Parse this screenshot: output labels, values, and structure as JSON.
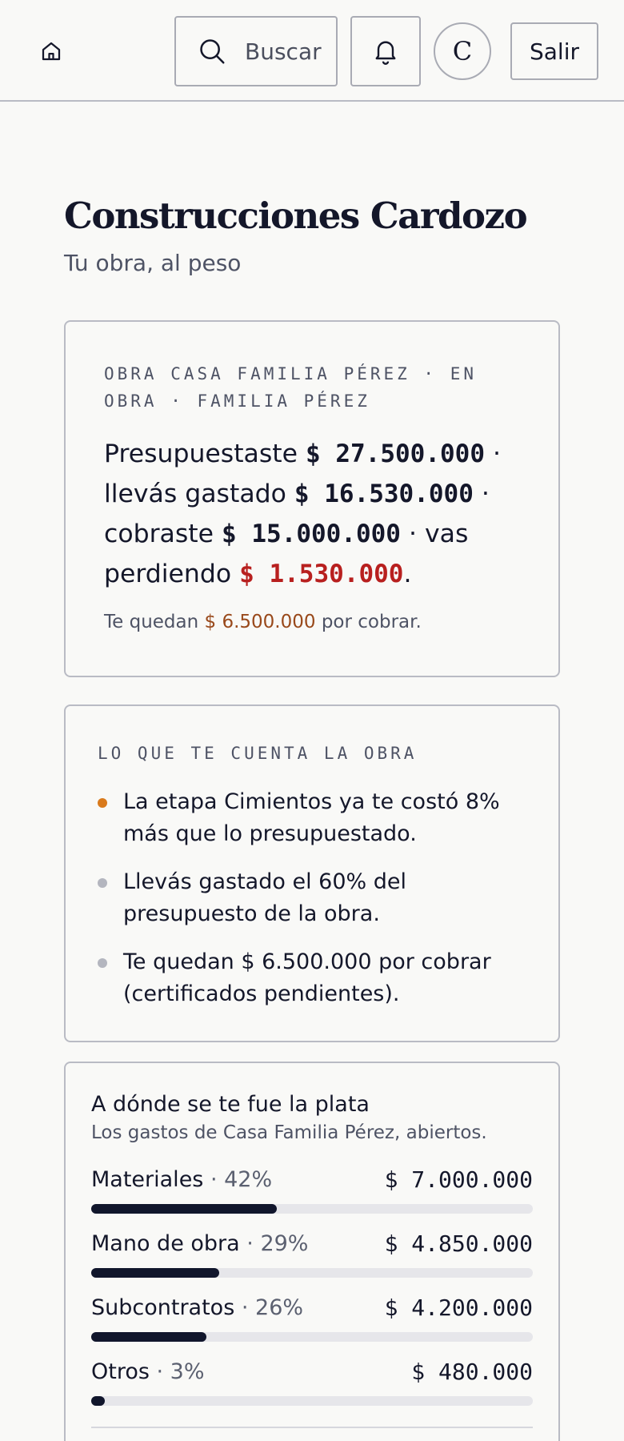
{
  "header": {
    "search_label": "Buscar",
    "avatar_initial": "C",
    "logout_label": "Salir"
  },
  "company": {
    "title": "Construcciones Cardozo",
    "subtitle": "Tu obra, al peso"
  },
  "summary": {
    "eyebrow": "OBRA CASA FAMILIA PÉREZ · EN OBRA · FAMILIA PÉREZ",
    "t1": "Presupuestaste ",
    "budget": "$ 27.500.000",
    "t2": " · llevás gastado ",
    "spent": "$ 16.530.000",
    "t3": " · cobraste ",
    "collected": "$ 15.000.000",
    "t4": " · vas perdiendo ",
    "loss": "$ 1.530.000",
    "t5": ".",
    "foot_pre": "Te quedan ",
    "foot_amount": "$ 6.500.000",
    "foot_post": " por cobrar."
  },
  "insights": {
    "eyebrow": "LO QUE TE CUENTA LA OBRA",
    "items": [
      {
        "text": "La etapa Cimientos ya te costó 8% más que lo presupuestado.",
        "dot_color": "#d97a1c"
      },
      {
        "text": "Llevás gastado el 60% del presupuesto de la obra.",
        "dot_color": "#b4b6bf"
      },
      {
        "text": "Te quedan $ 6.500.000 por cobrar (certificados pendientes).",
        "dot_color": "#b4b6bf"
      }
    ]
  },
  "spend": {
    "title": "A dónde se te fue la plata",
    "subtitle": "Los gastos de Casa Familia Pérez, abiertos.",
    "rows": [
      {
        "label": "Materiales",
        "pct": " · 42%",
        "amount": "$ 7.000.000",
        "fraction": 0.42
      },
      {
        "label": "Mano de obra",
        "pct": " · 29%",
        "amount": "$ 4.850.000",
        "fraction": 0.29
      },
      {
        "label": "Subcontratos",
        "pct": " · 26%",
        "amount": "$ 4.200.000",
        "fraction": 0.26
      },
      {
        "label": "Otros",
        "pct": " · 3%",
        "amount": "$ 480.000",
        "fraction": 0.03
      }
    ]
  },
  "colors": {
    "accent_dark": "#11162c",
    "loss_red": "#b8201f",
    "pending_amber": "#99491b"
  }
}
